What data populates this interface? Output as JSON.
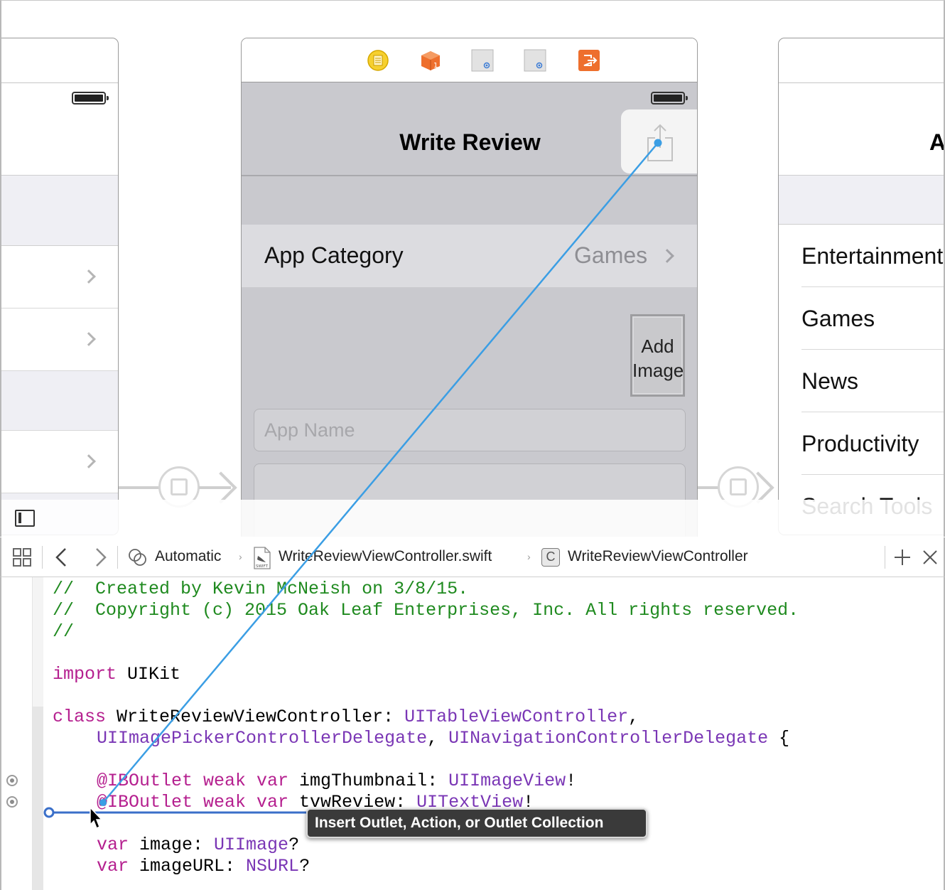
{
  "center_scene": {
    "dock_icons": [
      "view-controller-icon",
      "first-responder-icon",
      "placeholder-object-icon",
      "placeholder-object-icon",
      "exit-icon"
    ],
    "nav_title": "Write Review",
    "share_button_icon": "share-icon",
    "category_row": {
      "label": "App Category",
      "value": "Games"
    },
    "add_image_button": {
      "line1": "Add",
      "line2": "Image"
    },
    "app_name_field": {
      "placeholder": "App Name"
    }
  },
  "right_scene": {
    "title_partial": "A",
    "items": [
      "Entertainment",
      "Games",
      "News",
      "Productivity",
      "Search Tools"
    ]
  },
  "jump_bar": {
    "related_items_icon": "related-items-icon",
    "mode": "Automatic",
    "file": "WriteReviewViewController.swift",
    "file_icon_label": "SWIFT",
    "symbol_badge": "C",
    "symbol": "WriteReviewViewController"
  },
  "code": {
    "line1": "//  Created by Kevin McNeish on 3/8/15.",
    "line2": "//  Copyright (c) 2015 Oak Leaf Enterprises, Inc. All rights reserved.",
    "line3": "//",
    "line4_kw": "import",
    "line4_rest": " UIKit",
    "line5_kw": "class",
    "line5_name": " WriteReviewViewController: ",
    "line5_type": "UITableViewController",
    "line5_end": ",",
    "line6_type1": "UIImagePickerControllerDelegate",
    "line6_mid": ", ",
    "line6_type2": "UINavigationControllerDelegate",
    "line6_end": " {",
    "line7_kw": "@IBOutlet weak var",
    "line7_name": " imgThumbnail: ",
    "line7_type": "UIImageView",
    "line7_end": "!",
    "line8_kw": "@IBOutlet weak var",
    "line8_name": " tvwReview: ",
    "line8_type": "UITextView",
    "line8_end": "!",
    "line9_kw": "var",
    "line9_name": " image: ",
    "line9_type": "UIImage",
    "line9_end": "?",
    "line10_kw": "var",
    "line10_name": " imageURL: ",
    "line10_type": "NSURL",
    "line10_end": "?"
  },
  "tooltip": "Insert Outlet, Action, or Outlet Collection",
  "colors": {
    "connection_line": "#3b9ee4",
    "insertion_line": "#3a6fc9",
    "comment": "#1f8a1f",
    "keyword": "#b5208f",
    "type": "#7a36b5"
  }
}
